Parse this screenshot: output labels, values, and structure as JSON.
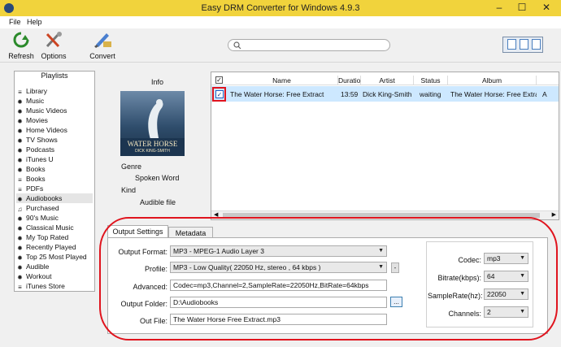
{
  "window": {
    "title": "Easy DRM Converter for Windows 4.9.3",
    "minimize": "–",
    "maximize": "☐",
    "close": "✕"
  },
  "menu": [
    "File",
    "Help"
  ],
  "toolbar": {
    "refresh": "Refresh",
    "options": "Options",
    "convert": "Convert"
  },
  "search": {
    "placeholder": ""
  },
  "playlists": {
    "header": "Playlists",
    "items": [
      {
        "label": "Library",
        "icon": "list-icon"
      },
      {
        "label": "Music",
        "icon": "gear-icon"
      },
      {
        "label": "Music Videos",
        "icon": "gear-icon"
      },
      {
        "label": "Movies",
        "icon": "gear-icon"
      },
      {
        "label": "Home Videos",
        "icon": "gear-icon"
      },
      {
        "label": "TV Shows",
        "icon": "gear-icon"
      },
      {
        "label": "Podcasts",
        "icon": "gear-icon"
      },
      {
        "label": "iTunes U",
        "icon": "gear-icon"
      },
      {
        "label": "Books",
        "icon": "gear-icon"
      },
      {
        "label": "Books",
        "icon": "list-icon"
      },
      {
        "label": "PDFs",
        "icon": "list-icon"
      },
      {
        "label": "Audiobooks",
        "icon": "gear-icon"
      },
      {
        "label": "Purchased",
        "icon": "note-icon"
      },
      {
        "label": "90's Music",
        "icon": "gear-icon"
      },
      {
        "label": "Classical Music",
        "icon": "gear-icon"
      },
      {
        "label": "My Top Rated",
        "icon": "gear-icon"
      },
      {
        "label": "Recently Played",
        "icon": "gear-icon"
      },
      {
        "label": "Top 25 Most Played",
        "icon": "gear-icon"
      },
      {
        "label": "Audible",
        "icon": "gear-icon"
      },
      {
        "label": "Workout",
        "icon": "gear-icon"
      },
      {
        "label": "iTunes Store",
        "icon": "list-icon"
      }
    ],
    "selected_index": 11
  },
  "info": {
    "header": "Info",
    "cover": {
      "title": "WATER HORSE",
      "author": "DICK KING-SMITH"
    },
    "genre_label": "Genre",
    "genre_value": "Spoken Word",
    "kind_label": "Kind",
    "kind_value": "Audible file"
  },
  "tracks": {
    "columns": [
      "Name",
      "Duration",
      "Artist",
      "Status",
      "Album"
    ],
    "rows": [
      {
        "checked": true,
        "name": "The Water Horse: Free Extract",
        "duration": "13:59",
        "artist": "Dick King-Smith",
        "status": "waiting",
        "album": "The Water Horse: Free Extract",
        "extra": "A"
      }
    ]
  },
  "settings": {
    "tabs": [
      "Output Settings",
      "Metadata"
    ],
    "active_tab": 0,
    "output_format_label": "Output Format:",
    "output_format_value": "MP3 - MPEG-1 Audio Layer 3",
    "profile_label": "Profile:",
    "profile_value": "MP3 - Low Quality( 22050 Hz, stereo , 64 kbps )",
    "profile_button": "-",
    "advanced_label": "Advanced:",
    "advanced_value": "Codec=mp3,Channel=2,SampleRate=22050Hz,BitRate=64kbps",
    "output_folder_label": "Output Folder:",
    "output_folder_value": "D:\\Audiobooks",
    "browse_button": "...",
    "out_file_label": "Out File:",
    "out_file_value": "The Water Horse Free Extract.mp3",
    "codec_label": "Codec:",
    "codec_value": "mp3",
    "bitrate_label": "Bitrate(kbps):",
    "bitrate_value": "64",
    "samplerate_label": "SampleRate(hz):",
    "samplerate_value": "22050",
    "channels_label": "Channels:",
    "channels_value": "2"
  },
  "colors": {
    "titlebar": "#f1d33c",
    "highlight": "#e0141e",
    "selection": "#cde8ff"
  }
}
